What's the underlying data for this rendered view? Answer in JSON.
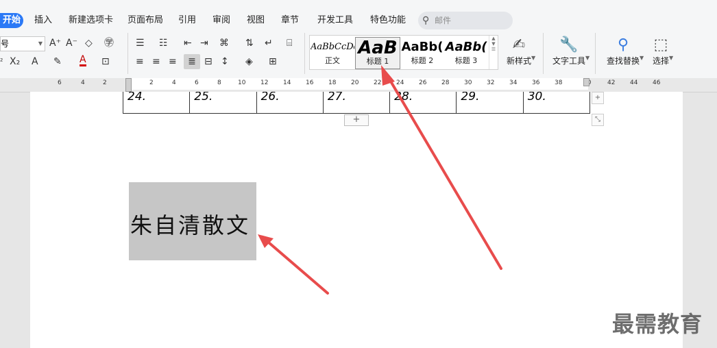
{
  "menu": {
    "active_tab": "开始",
    "tabs": [
      "插入",
      "新建选项卡",
      "页面布局",
      "引用",
      "审阅",
      "视图",
      "章节",
      "开发工具",
      "特色功能"
    ],
    "search_placeholder": "邮件"
  },
  "font": {
    "size_field": "号"
  },
  "styles": {
    "items": [
      {
        "sample": "AaBbCcDd",
        "label": "正文"
      },
      {
        "sample": "AaB",
        "label": "标题 1"
      },
      {
        "sample": "AaBb(",
        "label": "标题 2"
      },
      {
        "sample": "AaBb(",
        "label": "标题 3"
      }
    ],
    "selected_index": 1
  },
  "tools": {
    "new_style": "新样式",
    "text_tools": "文字工具",
    "find_replace": "查找替换",
    "select": "选择"
  },
  "ruler": {
    "ticks": [
      "6",
      "4",
      "2",
      "2",
      "4",
      "6",
      "8",
      "10",
      "12",
      "14",
      "16",
      "18",
      "20",
      "22",
      "24",
      "26",
      "28",
      "30",
      "32",
      "34",
      "36",
      "38",
      "40",
      "42",
      "44",
      "46"
    ]
  },
  "table": {
    "cells": [
      "24.",
      "25.",
      "26.",
      "27.",
      "28.",
      "29.",
      "30."
    ]
  },
  "table_controls": {
    "add_row": "+",
    "add_col": "+",
    "resize": "⤡"
  },
  "document": {
    "heading": "朱自清散文"
  },
  "watermark": "最需教育",
  "colors": {
    "accent": "#2b79f6",
    "arrow": "#e84c4c",
    "highlight": "#c6c6c6"
  }
}
